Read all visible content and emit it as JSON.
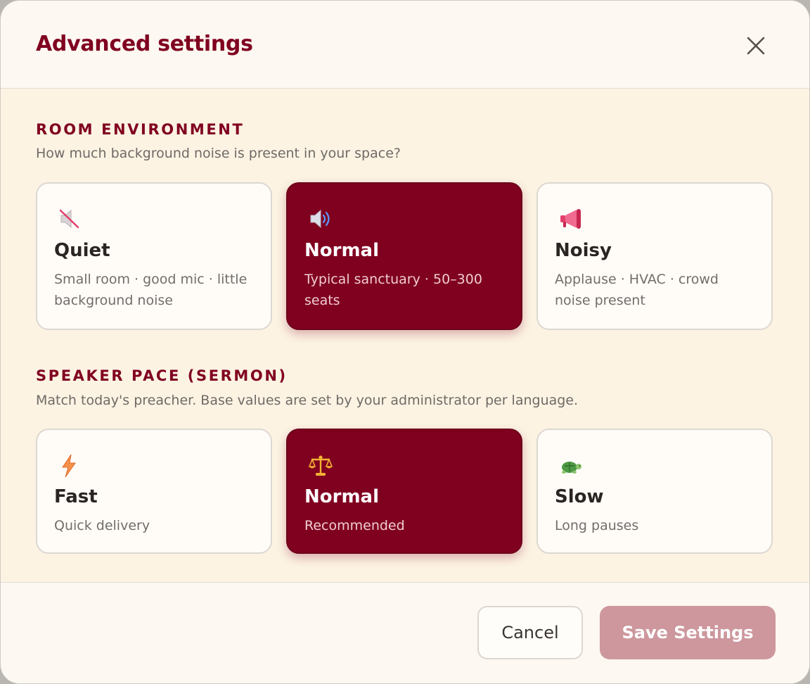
{
  "dialog": {
    "title": "Advanced settings"
  },
  "room": {
    "heading": "ROOM ENVIRONMENT",
    "description": "How much background noise is present in your space?",
    "options": [
      {
        "title": "Quiet",
        "desc": "Small room · good mic · little background noise",
        "icon": "muted-speaker-icon",
        "selected": false
      },
      {
        "title": "Normal",
        "desc": "Typical sanctuary · 50–300 seats",
        "icon": "speaker-icon",
        "selected": true
      },
      {
        "title": "Noisy",
        "desc": "Applause · HVAC · crowd noise present",
        "icon": "megaphone-icon",
        "selected": false
      }
    ]
  },
  "pace": {
    "heading": "SPEAKER PACE (SERMON)",
    "description": "Match today's preacher. Base values are set by your administrator per language.",
    "options": [
      {
        "title": "Fast",
        "desc": "Quick delivery",
        "icon": "lightning-icon",
        "selected": false
      },
      {
        "title": "Normal",
        "desc": "Recommended",
        "icon": "scales-icon",
        "selected": true
      },
      {
        "title": "Slow",
        "desc": "Long pauses",
        "icon": "turtle-icon",
        "selected": false
      }
    ]
  },
  "footer": {
    "cancel_label": "Cancel",
    "save_label": "Save Settings"
  },
  "colors": {
    "accent": "#800020",
    "save_disabled": "#cd979d",
    "body_background": "#fcf3e3"
  }
}
